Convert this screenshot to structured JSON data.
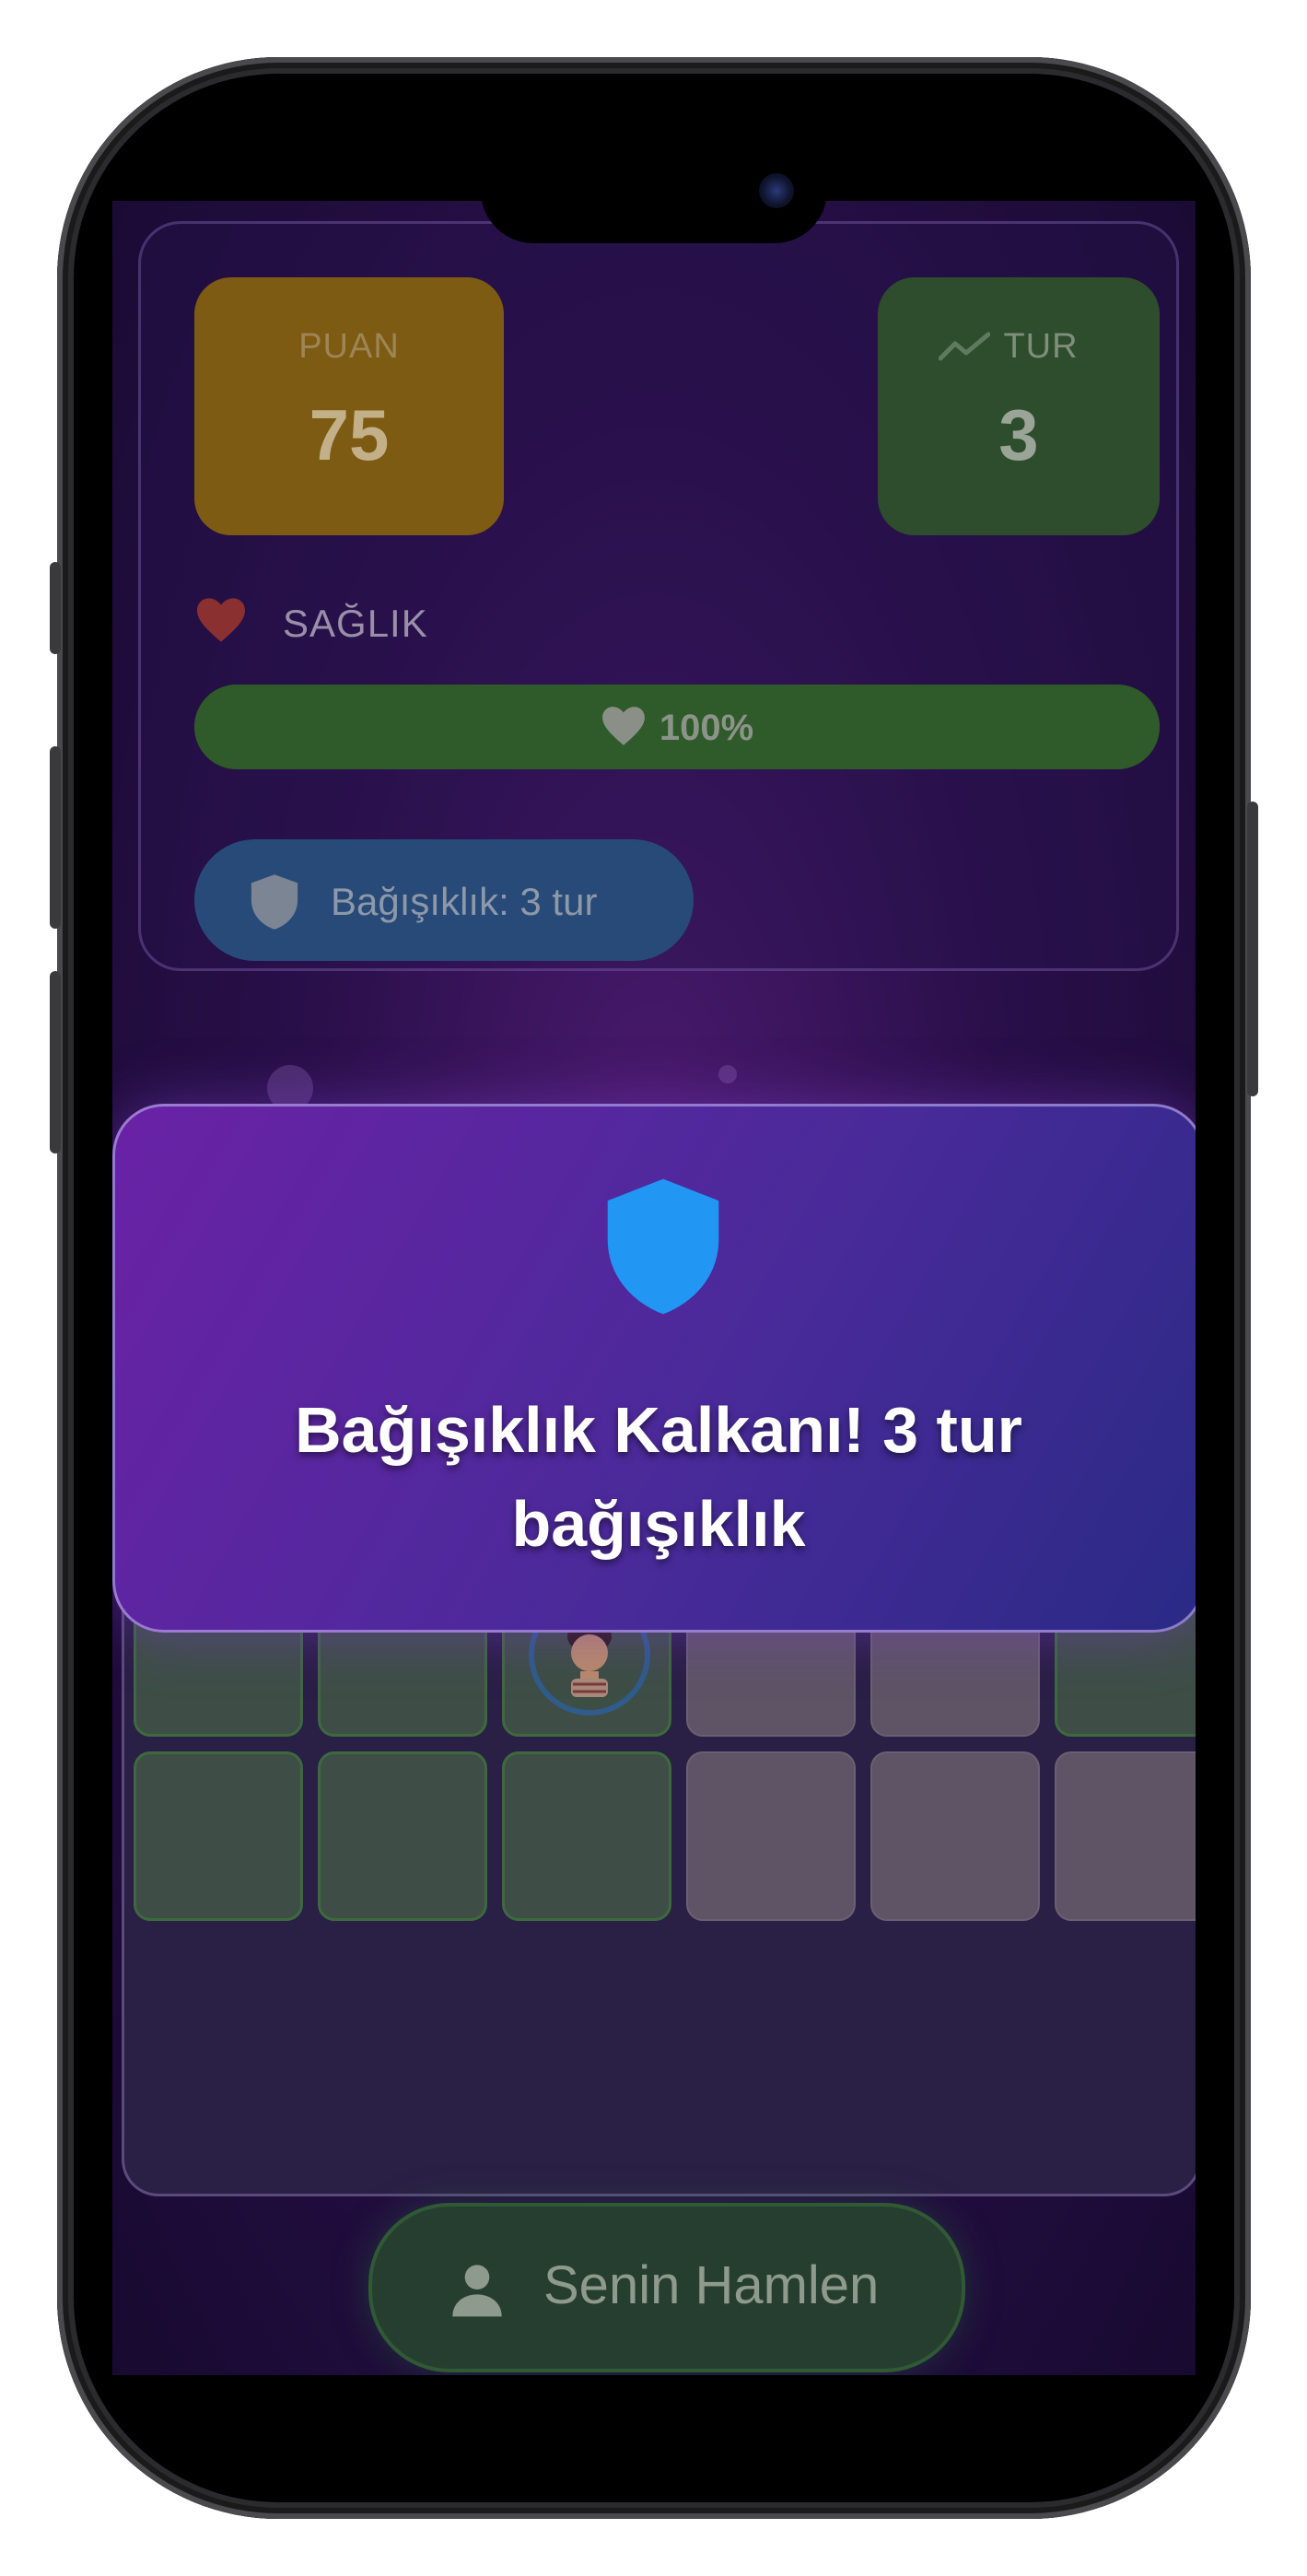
{
  "stats": {
    "score_label": "PUAN",
    "score_value": "75",
    "turn_label": "TUR",
    "turn_value": "3"
  },
  "health": {
    "label": "SAĞLIK",
    "percent_text": "100%",
    "percent": 100
  },
  "immunity": {
    "badge_text": "Bağışıklık: 3 tur"
  },
  "toast": {
    "message": "Bağışıklık Kalkanı! 3 tur bağışıklık",
    "icon": "shield-icon"
  },
  "board": {
    "icons": [
      "dice-icon",
      "player-avatar"
    ]
  },
  "action": {
    "label": "Senin Hamlen",
    "icon": "person-icon"
  },
  "colors": {
    "score_card": "#7d5b12",
    "turn_card": "#2e4d2c",
    "health_bar": "#2f5a2a",
    "immunity_badge": "#274a78",
    "toast_gradient_start": "#6a22a6",
    "toast_gradient_end": "#2a2a86",
    "shield_blue": "#2196f3"
  }
}
